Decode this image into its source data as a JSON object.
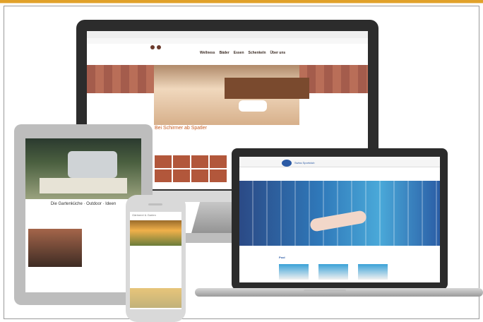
{
  "monitor": {
    "site_heading": "Bei Schirmer ab Spatler",
    "nav": [
      "Wellness",
      "Bäder",
      "Essen",
      "Schenkeln",
      "Über uns"
    ]
  },
  "tablet": {
    "site_title": "Die Gartenküche · Outdoor · Ideen"
  },
  "phone": {
    "header": "Gärtnerei & Garten"
  },
  "laptop": {
    "brand": "Swiss Sportclub",
    "section": "Pool"
  }
}
